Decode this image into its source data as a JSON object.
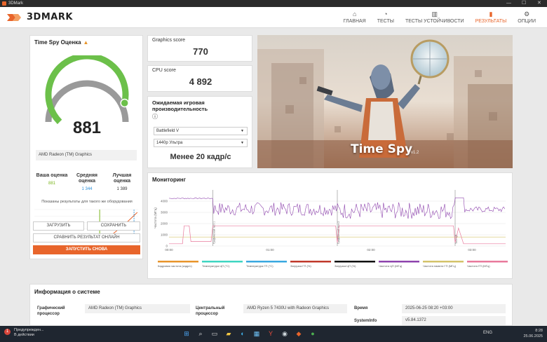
{
  "window": {
    "title": "3DMark"
  },
  "header": {
    "logo_text": "3DMARK"
  },
  "nav": [
    {
      "icon": "home-icon",
      "glyph": "⌂",
      "label": "ГЛАВНАЯ"
    },
    {
      "icon": "gauge-icon",
      "glyph": "◔",
      "label": "ТЕСТЫ"
    },
    {
      "icon": "bars-icon",
      "glyph": "▥",
      "label": "ТЕСТЫ УСТОЙЧИВОСТИ"
    },
    {
      "icon": "results-icon",
      "glyph": "▮",
      "label": "РЕЗУЛЬТАТЫ"
    },
    {
      "icon": "gear-icon",
      "glyph": "⚙",
      "label": "ОПЦИИ"
    }
  ],
  "score_card": {
    "title": "Time Spy Оценка",
    "score": "881",
    "gauge_fraction": 0.88,
    "gpu": "AMD Radeon (TM) Graphics",
    "stats": [
      {
        "label": "Ваша оценка",
        "value": "881",
        "color": "#7ab51d"
      },
      {
        "label": "Средняя оценка",
        "value": "1 344",
        "color": "#2a8fd8"
      },
      {
        "label": "Лучшая оценка",
        "value": "1 389",
        "color": "#333333"
      }
    ],
    "note": "Показаны результаты для такого же оборудования",
    "mini_chart": {
      "type": "line",
      "x_ticks": [
        "250",
        "500",
        "750",
        "1000",
        "1250"
      ],
      "your_score": 881,
      "average": 1344,
      "best": 1389
    },
    "buttons": {
      "load": "ЗАГРУЗИТЬ",
      "save": "СОХРАНИТЬ",
      "compare": "СРАВНИТЬ РЕЗУЛЬТАТ ОНЛАЙН",
      "run": "ЗАПУСТИТЬ СНОВА"
    }
  },
  "graphics_score": {
    "label": "Graphics score",
    "value": "770"
  },
  "cpu_score": {
    "label": "CPU score",
    "value": "4 892"
  },
  "fps": {
    "title": "Ожидаемая игровая производительность",
    "game": "Battlefield V",
    "preset": "1440p Ультра",
    "result": "Менее 20 кадр/с"
  },
  "hero": {
    "title": "Time Spy",
    "version": "v1.2"
  },
  "monitor": {
    "title": "Мониторинг",
    "chart_data": {
      "type": "line",
      "x_ticks": [
        "00:00",
        "01:00",
        "02:00",
        "03:00"
      ],
      "y_ticks": [
        "4000",
        "3000",
        "2000",
        "1000",
        "0"
      ],
      "ylabel": "Частота (МГц)",
      "ylim": [
        0,
        5000
      ],
      "phase_labels": [
        "Графический тест 1",
        "Графический тест 2",
        "Тест ЦП"
      ],
      "legend": [
        {
          "name": "Кадровая частота (кадр/с)",
          "color": "#e8952b"
        },
        {
          "name": "Температура ЦП (°C)",
          "color": "#3fd6c2"
        },
        {
          "name": "Температура ГП (°C)",
          "color": "#3aa8e0"
        },
        {
          "name": "Загрузка ГП (%)",
          "color": "#c0392b"
        },
        {
          "name": "Загрузка ЦП (%)",
          "color": "#111111"
        },
        {
          "name": "Частота ЦП (МГц)",
          "color": "#8e44ad"
        },
        {
          "name": "Частота памяти ГП (МГц)",
          "color": "#d4c36a"
        },
        {
          "name": "Частота ГП (МГц)",
          "color": "#e87a9c"
        }
      ]
    }
  },
  "system_info": {
    "title": "Информация о системе",
    "gpu_label": "Графический процессор",
    "gpu_value": "AMD Radeon (TM) Graphics",
    "cpu_label": "Центральный процессор",
    "cpu_value": "AMD Ryzen 5 7430U with Radeon Graphics",
    "time_label": "Время",
    "time_value": "2025-06-25 08:20 +03:00",
    "sysinfo_label": "SystemInfo",
    "sysinfo_value": "v5.84.1372"
  },
  "taskbar": {
    "notif_line1": "Предупрежден...",
    "notif_line2": "В действии",
    "badge": "1",
    "lang": "ENG",
    "time": "8:28",
    "date": "25.06.2025"
  }
}
